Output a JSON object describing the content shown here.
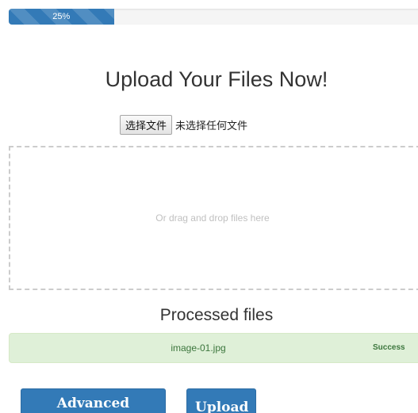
{
  "progress": {
    "percent": 25,
    "label": "25%"
  },
  "upload": {
    "title": "Upload Your Files Now!",
    "file_button_label": "选择文件",
    "file_status": "未选择任何文件"
  },
  "dropzone": {
    "text": "Or drag and drop files here"
  },
  "processed": {
    "title": "Processed files",
    "items": [
      {
        "name": "image-01.jpg",
        "status": "Success"
      }
    ]
  },
  "actions": {
    "advanced_upload_label": "Advanced Upload",
    "upload_label": "Upload"
  },
  "colors": {
    "primary": "#337ab7",
    "success_bg": "#dff0d8",
    "success_text": "#3c763d"
  }
}
